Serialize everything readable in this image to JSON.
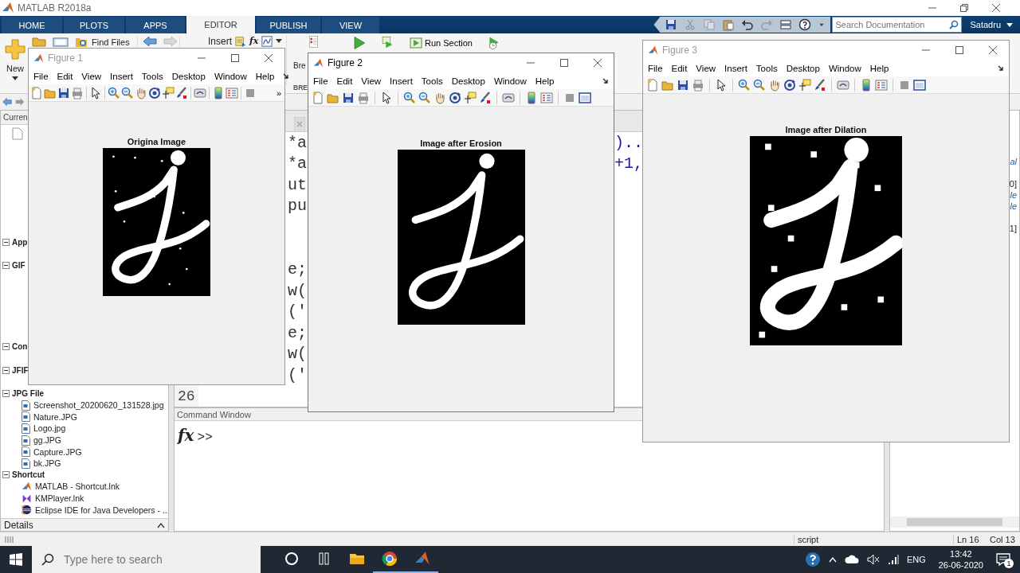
{
  "app_window": {
    "title": "MATLAB R2018a"
  },
  "ribbon_tabs": [
    {
      "label": "HOME",
      "selected": false
    },
    {
      "label": "PLOTS",
      "selected": false
    },
    {
      "label": "APPS",
      "selected": false
    },
    {
      "label": "EDITOR",
      "selected": true
    },
    {
      "label": "PUBLISH",
      "selected": false
    },
    {
      "label": "VIEW",
      "selected": false
    }
  ],
  "quick_access": {
    "search": {
      "placeholder": "Search Documentation"
    },
    "user": "Satadru"
  },
  "toolstrip": {
    "new": "New",
    "find_files": "Find Files",
    "insert": "Insert",
    "fx": "fx",
    "breakpoints": "Bre",
    "run_section": "Run Section",
    "section_label": "BRE"
  },
  "current_folder": {
    "header": "Curren",
    "groups": [
      {
        "label": "App",
        "expanded": true
      },
      {
        "label": "GIF",
        "expanded": true
      },
      {
        "label": "Con",
        "expanded": true
      },
      {
        "label": "JFIF",
        "expanded": true
      },
      {
        "label": "JPG File",
        "expanded": true,
        "children": [
          {
            "name": "Screenshot_20200620_131528.jpg"
          },
          {
            "name": "Nature.JPG"
          },
          {
            "name": "Logo.jpg"
          },
          {
            "name": "gg.JPG"
          },
          {
            "name": "Capture.JPG"
          },
          {
            "name": "bk.JPG"
          }
        ]
      },
      {
        "label": "Shortcut",
        "expanded": true,
        "children": [
          {
            "name": "MATLAB - Shortcut.lnk",
            "kind": "matlab"
          },
          {
            "name": "KMPlayer.lnk",
            "kind": "player"
          },
          {
            "name": "Eclipse IDE for Java Developers - ...",
            "kind": "eclipse"
          }
        ]
      }
    ],
    "details": "Details"
  },
  "editor": {
    "lines": [
      {
        "code": "*a",
        "tail": ").."
      },
      {
        "code": "*a",
        "tail": "+1,"
      },
      {
        "code": "ut"
      },
      {
        "code": "pu"
      },
      {
        "code": "e;"
      },
      {
        "code": "w("
      },
      {
        "code": "('"
      },
      {
        "code": "e;"
      },
      {
        "code": "w("
      },
      {
        "code": "('"
      },
      {
        "number": "26"
      }
    ]
  },
  "command_window": {
    "title": "Command Window",
    "fx": "fx",
    "prompt": ">>"
  },
  "workspace": {
    "rows": [
      {
        "text": "al",
        "kind": "link"
      },
      {
        "text": "0]",
        "kind": "value"
      },
      {
        "text": "le",
        "kind": "link"
      },
      {
        "text": "le",
        "kind": "link"
      },
      {
        "text": "1]",
        "kind": "value"
      }
    ]
  },
  "status_bar": {
    "mode": "script",
    "line": "Ln 16",
    "column": "Col 13"
  },
  "figures": [
    {
      "title": "Figure 1",
      "active": false,
      "menu": [
        "File",
        "Edit",
        "View",
        "Insert",
        "Tools",
        "Desktop",
        "Window",
        "Help"
      ],
      "overflow": "»",
      "axes_title": "Origina Image"
    },
    {
      "title": "Figure 2",
      "active": true,
      "menu": [
        "File",
        "Edit",
        "View",
        "Insert",
        "Tools",
        "Desktop",
        "Window",
        "Help"
      ],
      "axes_title": "Image after Erosion"
    },
    {
      "title": "Figure 3",
      "active": false,
      "menu": [
        "File",
        "Edit",
        "View",
        "Insert",
        "Tools",
        "Desktop",
        "Window",
        "Help"
      ],
      "axes_title": "Image after Dilation"
    }
  ],
  "taskbar": {
    "search_placeholder": "Type here to search",
    "apps": [
      {
        "kind": "cortana",
        "running": false
      },
      {
        "kind": "taskview",
        "running": false
      },
      {
        "kind": "folder",
        "running": false
      },
      {
        "kind": "browser",
        "running": true
      },
      {
        "kind": "matlab",
        "running": true
      }
    ],
    "language": "ENG",
    "time": "13:42",
    "date": "26-06-2020",
    "notifications": "1"
  }
}
